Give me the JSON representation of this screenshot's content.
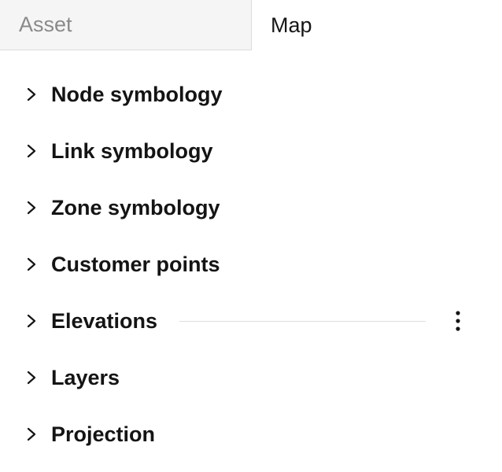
{
  "tabs": [
    {
      "label": "Asset",
      "active": false
    },
    {
      "label": "Map",
      "active": true
    }
  ],
  "sections": [
    {
      "label": "Node symbology",
      "expanded": false
    },
    {
      "label": "Link symbology",
      "expanded": false
    },
    {
      "label": "Zone symbology",
      "expanded": false
    },
    {
      "label": "Customer points",
      "expanded": false
    },
    {
      "label": "Elevations",
      "expanded": false,
      "has_menu": true,
      "menu_icon": "more-vertical-icon"
    },
    {
      "label": "Layers",
      "expanded": false
    },
    {
      "label": "Projection",
      "expanded": false
    }
  ],
  "icons": {
    "section_toggle": "chevron-right-icon"
  },
  "colors": {
    "inactive_tab_bg": "#f5f5f5",
    "inactive_tab_text": "#8a8a8a",
    "text": "#141414",
    "divider": "#dedede"
  }
}
